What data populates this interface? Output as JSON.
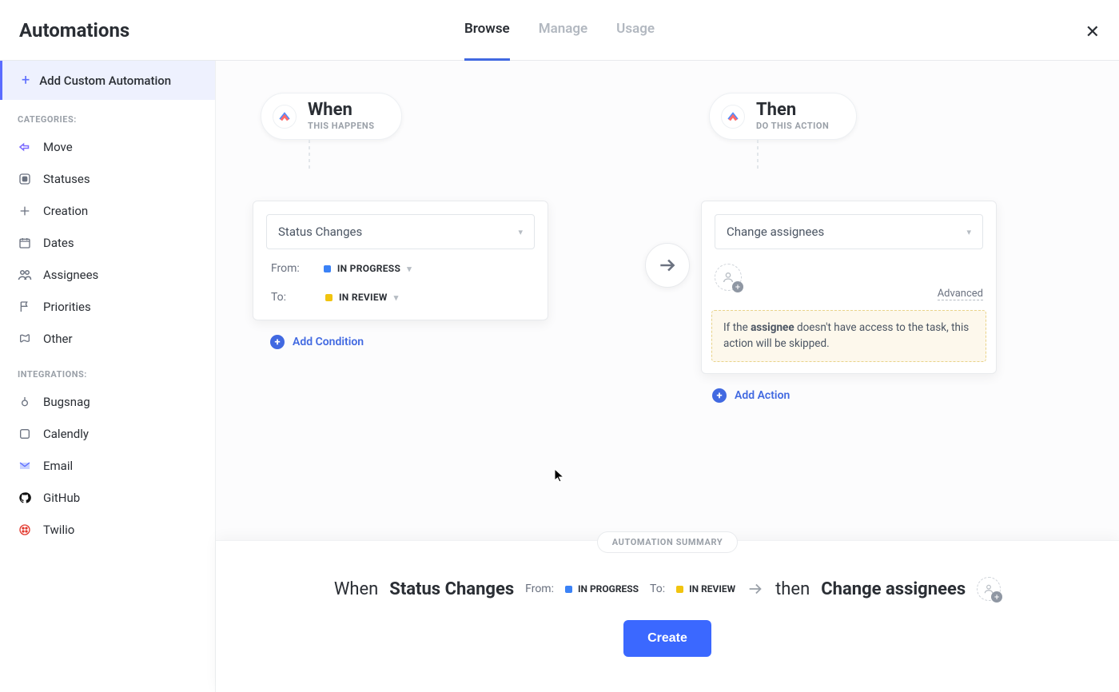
{
  "header": {
    "title": "Automations",
    "tabs": [
      {
        "label": "Browse",
        "active": true
      },
      {
        "label": "Manage",
        "active": false
      },
      {
        "label": "Usage",
        "active": false
      }
    ]
  },
  "sidebar": {
    "add_custom_label": "Add Custom Automation",
    "categories_label": "CATEGORIES:",
    "categories": [
      {
        "label": "Move",
        "icon": "move-icon"
      },
      {
        "label": "Statuses",
        "icon": "status-icon"
      },
      {
        "label": "Creation",
        "icon": "creation-icon"
      },
      {
        "label": "Dates",
        "icon": "dates-icon"
      },
      {
        "label": "Assignees",
        "icon": "assignees-icon"
      },
      {
        "label": "Priorities",
        "icon": "priorities-icon"
      },
      {
        "label": "Other",
        "icon": "other-icon"
      }
    ],
    "integrations_label": "INTEGRATIONS:",
    "integrations": [
      {
        "label": "Bugsnag",
        "icon": "bugsnag-icon"
      },
      {
        "label": "Calendly",
        "icon": "calendly-icon"
      },
      {
        "label": "Email",
        "icon": "email-icon"
      },
      {
        "label": "GitHub",
        "icon": "github-icon"
      },
      {
        "label": "Twilio",
        "icon": "twilio-icon"
      }
    ]
  },
  "builder": {
    "when": {
      "title": "When",
      "subtitle": "THIS HAPPENS",
      "trigger_select": "Status Changes",
      "from_label": "From:",
      "from_status": "IN PROGRESS",
      "from_color": "blue",
      "to_label": "To:",
      "to_status": "IN REVIEW",
      "to_color": "yellow",
      "add_condition_label": "Add Condition"
    },
    "then": {
      "title": "Then",
      "subtitle": "DO THIS ACTION",
      "action_select": "Change assignees",
      "advanced_label": "Advanced",
      "warning_pre": "If the ",
      "warning_bold": "assignee",
      "warning_post": " doesn't have access to the task, this action will be skipped.",
      "add_action_label": "Add Action"
    }
  },
  "summary": {
    "label": "AUTOMATION SUMMARY",
    "when_word": "When",
    "trigger": "Status Changes",
    "from_label": "From:",
    "from_status": "IN PROGRESS",
    "to_label": "To:",
    "to_status": "IN REVIEW",
    "then_word": "then",
    "action": "Change assignees",
    "create_button": "Create"
  }
}
